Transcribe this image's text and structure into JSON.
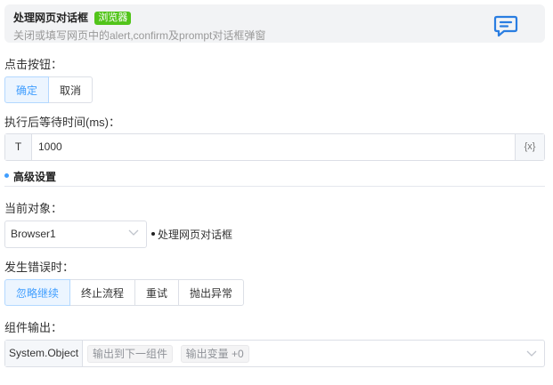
{
  "header": {
    "title": "处理网页对话框",
    "tag": "浏览器",
    "description": "关闭或填写网页中的alert,confirm及prompt对话框弹窗",
    "icon": "chat-icon"
  },
  "click_button": {
    "label": "点击按钮：",
    "options": [
      "确定",
      "取消"
    ],
    "selected": "确定"
  },
  "wait_time": {
    "label": "执行后等待时间(ms)：",
    "prefix": "T",
    "value": "1000",
    "suffix": "{x}"
  },
  "advanced": {
    "title": "高级设置"
  },
  "current_object": {
    "label": "当前对象：",
    "value": "Browser1",
    "target": "处理网页对话框"
  },
  "on_error": {
    "label": "发生错误时：",
    "options": [
      "忽略继续",
      "终止流程",
      "重试",
      "抛出异常"
    ],
    "selected": "忽略继续"
  },
  "output": {
    "label": "组件输出：",
    "type": "System.Object",
    "chips": [
      "输出到下一组件",
      "输出变量 +0"
    ]
  },
  "colors": {
    "accent": "#409eff",
    "tag_green": "#52c41a"
  }
}
